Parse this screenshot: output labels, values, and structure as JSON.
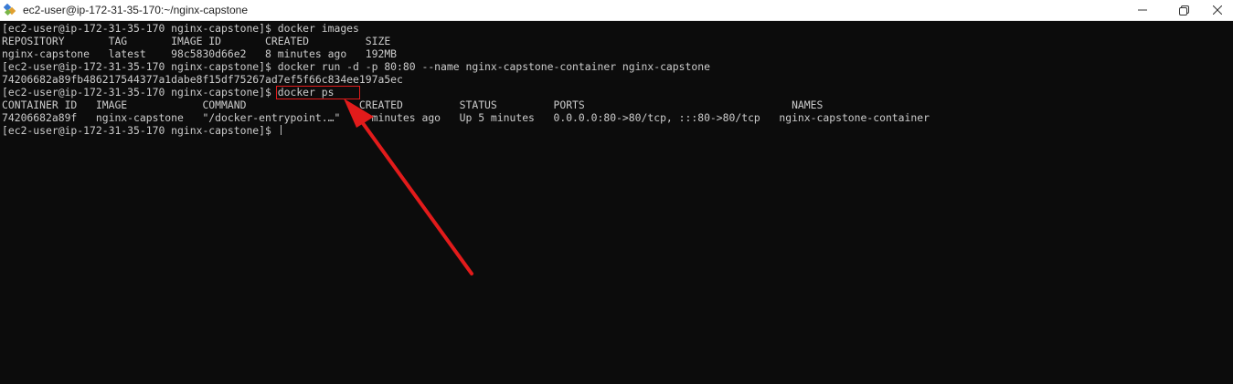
{
  "window": {
    "title": "ec2-user@ip-172-31-35-170:~/nginx-capstone",
    "app_icon": "putty-icon",
    "controls": {
      "minimize_icon": "minimize-icon",
      "maximize_icon": "maximize-icon",
      "close_icon": "close-icon"
    }
  },
  "terminal": {
    "lines": [
      "[ec2-user@ip-172-31-35-170 nginx-capstone]$ docker images",
      "REPOSITORY       TAG       IMAGE ID       CREATED         SIZE",
      "nginx-capstone   latest    98c5830d66e2   8 minutes ago   192MB",
      "[ec2-user@ip-172-31-35-170 nginx-capstone]$ docker run -d -p 80:80 --name nginx-capstone-container nginx-capstone",
      "74206682a89fb486217544377a1dabe8f15df75267ad7ef5f66c834ee197a5ec",
      "[ec2-user@ip-172-31-35-170 nginx-capstone]$ docker ps",
      "CONTAINER ID   IMAGE            COMMAND                  CREATED         STATUS         PORTS                                 NAMES",
      "74206682a89f   nginx-capstone   \"/docker-entrypoint.…\"   5 minutes ago   Up 5 minutes   0.0.0.0:80->80/tcp, :::80->80/tcp   nginx-capstone-container",
      "[ec2-user@ip-172-31-35-170 nginx-capstone]$ "
    ],
    "colors": {
      "background": "#0c0c0c",
      "foreground": "#cccccc"
    }
  },
  "annotation": {
    "highlight_color": "#e21b1b",
    "highlighted_text": "docker ps",
    "arrow_icon": "red-arrow-icon"
  }
}
